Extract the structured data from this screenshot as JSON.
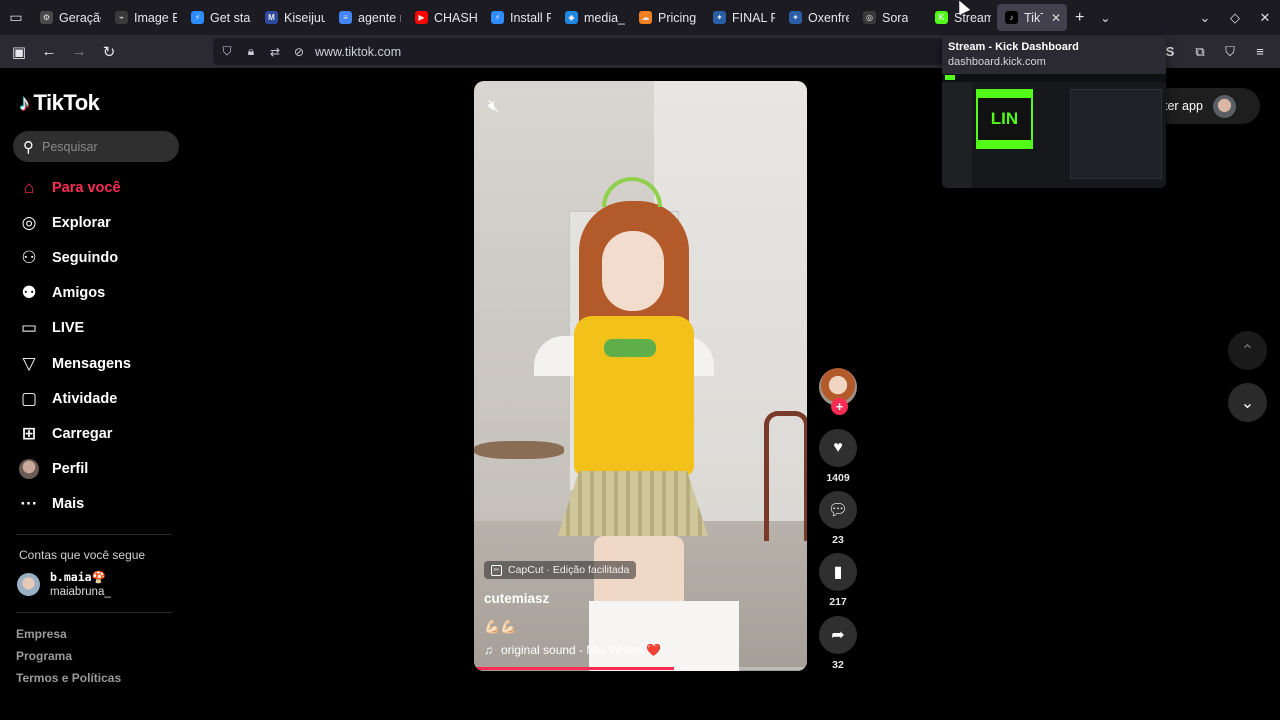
{
  "browser": {
    "tabs": [
      {
        "label": "Geração",
        "fav_color": "#4a4a4a",
        "fav_glyph": "⚙"
      },
      {
        "label": "Image E",
        "fav_color": "#3a3a3a",
        "fav_glyph": "⌁"
      },
      {
        "label": "Get star",
        "fav_color": "#2d8cff",
        "fav_glyph": "⚡"
      },
      {
        "label": "Kiseijuu",
        "fav_color": "#2e4a9e",
        "fav_glyph": "M"
      },
      {
        "label": "agente r",
        "fav_color": "#4285f4",
        "fav_glyph": "≡"
      },
      {
        "label": "CHASHK",
        "fav_color": "#ff0000",
        "fav_glyph": "▶"
      },
      {
        "label": "Install Fl",
        "fav_color": "#2d8cff",
        "fav_glyph": "⚡"
      },
      {
        "label": "media_k",
        "fav_color": "#1e88e5",
        "fav_glyph": "◆"
      },
      {
        "label": "Pricing",
        "fav_color": "#f38020",
        "fav_glyph": "☁"
      },
      {
        "label": "FINAL FA",
        "fav_color": "#2a5fa8",
        "fav_glyph": "✦"
      },
      {
        "label": "Oxenfre",
        "fav_color": "#2a5fa8",
        "fav_glyph": "✦"
      },
      {
        "label": "Sora",
        "fav_color": "#3a3a3a",
        "fav_glyph": "◎"
      },
      {
        "label": "Stream",
        "fav_color": "#53fc18",
        "fav_glyph": "K"
      },
      {
        "label": "TikTok",
        "fav_color": "#000000",
        "fav_glyph": "♪"
      }
    ],
    "url": "www.tiktok.com",
    "preview": {
      "title": "Stream - Kick Dashboard",
      "url": "dashboard.kick.com",
      "thumb_text": "LIN"
    }
  },
  "tiktok": {
    "logo": "TikTok",
    "search_placeholder": "Pesquisar",
    "menu": [
      {
        "label": "Para você",
        "icon": "home-icon",
        "glyph": "⌂"
      },
      {
        "label": "Explorar",
        "icon": "compass-icon",
        "glyph": "◎"
      },
      {
        "label": "Seguindo",
        "icon": "following-icon",
        "glyph": "⚇"
      },
      {
        "label": "Amigos",
        "icon": "friends-icon",
        "glyph": "⚉"
      },
      {
        "label": "LIVE",
        "icon": "live-icon",
        "glyph": "▭"
      },
      {
        "label": "Mensagens",
        "icon": "messages-icon",
        "glyph": "▽"
      },
      {
        "label": "Atividade",
        "icon": "activity-icon",
        "glyph": "▢"
      },
      {
        "label": "Carregar",
        "icon": "upload-icon",
        "glyph": "⊞"
      },
      {
        "label": "Perfil",
        "icon": "profile-avatar",
        "glyph": ""
      },
      {
        "label": "Mais",
        "icon": "more-icon",
        "glyph": "···"
      }
    ],
    "following_title": "Contas que você segue",
    "following": {
      "name": "b.maia🍄",
      "handle": "maiabruna_"
    },
    "footer": [
      "Empresa",
      "Programa",
      "Termos e Políticas"
    ],
    "get_app": "ter app",
    "video": {
      "capcut": "CapCut · Edição facilitada",
      "author": "cutemiasz",
      "description": "💪🏻💪🏻",
      "music": "original sound - Mia Whitte ❤️",
      "progress": 0.6
    },
    "actions": {
      "likes": "1409",
      "comments": "23",
      "saves": "217",
      "shares": "32"
    },
    "accent": "#fe2c55"
  }
}
